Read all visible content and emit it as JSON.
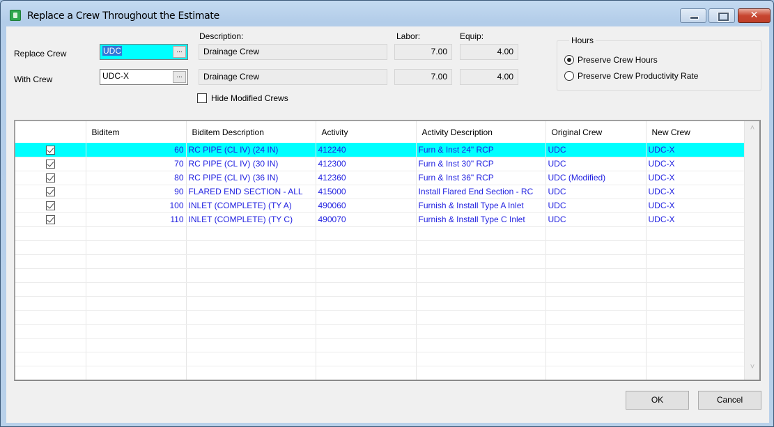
{
  "window": {
    "title": "Replace a Crew Throughout the Estimate",
    "app_icon": "estimate-app-icon",
    "controls": {
      "minimize": "minimize-icon",
      "maximize": "maximize-icon",
      "close_glyph": "✕"
    }
  },
  "form": {
    "labels": {
      "replace_crew": "Replace Crew",
      "with_crew": "With Crew",
      "description": "Description:",
      "labor": "Labor:",
      "equip": "Equip:"
    },
    "replace_crew": {
      "code": "UDC",
      "browse_label": "...",
      "description": "Drainage Crew",
      "labor": "7.00",
      "equip": "4.00"
    },
    "with_crew": {
      "code": "UDC-X",
      "browse_label": "...",
      "description": "Drainage Crew",
      "labor": "7.00",
      "equip": "4.00"
    },
    "hide_modified": {
      "label": "Hide Modified Crews",
      "checked": false
    }
  },
  "hours": {
    "title": "Hours",
    "options": [
      {
        "label": "Preserve Crew Hours",
        "selected": true
      },
      {
        "label": "Preserve Crew Productivity Rate",
        "selected": false
      }
    ]
  },
  "grid": {
    "columns": [
      "",
      "Biditem",
      "Biditem Description",
      "Activity",
      "Activity Description",
      "Original Crew",
      "New Crew"
    ],
    "rows": [
      {
        "checked": true,
        "biditem": "60",
        "biditem_desc": "RC PIPE (CL IV) (24 IN)",
        "activity": "412240",
        "activity_desc": "Furn & Inst 24\" RCP",
        "original_crew": "UDC",
        "new_crew": "UDC-X",
        "selected": true
      },
      {
        "checked": true,
        "biditem": "70",
        "biditem_desc": "RC PIPE (CL IV)  (30 IN)",
        "activity": "412300",
        "activity_desc": "Furn & Inst 30\" RCP",
        "original_crew": "UDC",
        "new_crew": "UDC-X",
        "selected": false
      },
      {
        "checked": true,
        "biditem": "80",
        "biditem_desc": "RC PIPE (CL IV)  (36 IN)",
        "activity": "412360",
        "activity_desc": "Furn & Inst 36\" RCP",
        "original_crew": "UDC (Modified)",
        "new_crew": "UDC-X",
        "selected": false
      },
      {
        "checked": true,
        "biditem": "90",
        "biditem_desc": "FLARED END SECTION - ALL",
        "activity": "415000",
        "activity_desc": "Install Flared End Section - RC",
        "original_crew": "UDC",
        "new_crew": "UDC-X",
        "selected": false
      },
      {
        "checked": true,
        "biditem": "100",
        "biditem_desc": "INLET (COMPLETE) (TY A)",
        "activity": "490060",
        "activity_desc": "Furnish & Install Type A Inlet",
        "original_crew": "UDC",
        "new_crew": "UDC-X",
        "selected": false
      },
      {
        "checked": true,
        "biditem": "110",
        "biditem_desc": "INLET (COMPLETE) (TY C)",
        "activity": "490070",
        "activity_desc": "Furnish & Install Type C Inlet",
        "original_crew": "UDC",
        "new_crew": "UDC-X",
        "selected": false
      }
    ],
    "empty_rows": 11,
    "scroll_up_glyph": "˄",
    "scroll_down_glyph": "˅"
  },
  "buttons": {
    "ok": "OK",
    "cancel": "Cancel"
  },
  "colors": {
    "selection": "#00ffff",
    "grid_text": "#1f1fe0",
    "close_button": "#c74530"
  }
}
